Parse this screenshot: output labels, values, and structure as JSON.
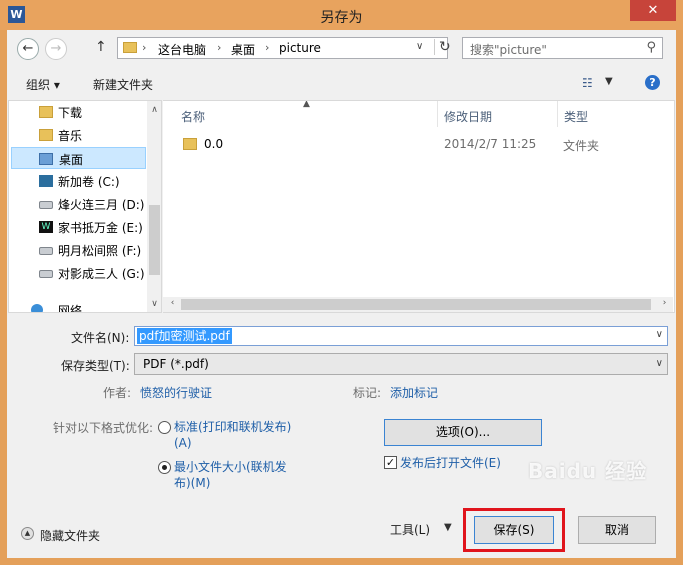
{
  "window": {
    "title": "另存为",
    "app_icon": "W",
    "close_glyph": "✕"
  },
  "nav": {
    "back_glyph": "←",
    "forward_glyph": "→",
    "up_glyph": "↑",
    "breadcrumbs": [
      "这台电脑",
      "桌面",
      "picture"
    ],
    "search_placeholder": "搜索\"picture\""
  },
  "toolbar": {
    "organize_label": "组织 ▾",
    "new_folder_label": "新建文件夹"
  },
  "sidebar": {
    "items": [
      {
        "label": "下载",
        "icon": "folder-icon"
      },
      {
        "label": "音乐",
        "icon": "folder-icon"
      },
      {
        "label": "桌面",
        "icon": "desktop-folder-icon",
        "selected": true
      },
      {
        "label": "新加卷 (C:)",
        "icon": "windows-drive-icon"
      },
      {
        "label": "烽火连三月 (D:)",
        "icon": "drive-icon"
      },
      {
        "label": "家书抵万金 (E:)",
        "icon": "app-drive-icon"
      },
      {
        "label": "明月松间照 (F:)",
        "icon": "drive-icon"
      },
      {
        "label": "对影成三人 (G:)",
        "icon": "drive-icon"
      },
      {
        "label": "网络",
        "icon": "network-icon"
      }
    ]
  },
  "filelist": {
    "columns": [
      "名称",
      "修改日期",
      "类型"
    ],
    "rows": [
      {
        "name": "0.0",
        "date": "2014/2/7 11:25",
        "type": "文件夹"
      }
    ]
  },
  "form": {
    "filename_label": "文件名(N):",
    "filename_value": "pdf加密测试.pdf",
    "savetype_label": "保存类型(T):",
    "savetype_value": "PDF (*.pdf)",
    "author_label": "作者:",
    "author_value": "愤怒的行驶证",
    "tags_label": "标记:",
    "tags_value": "添加标记",
    "optimize_label": "针对以下格式优化:",
    "radio_standard": "标准(打印和联机发布)(A)",
    "radio_minimum": "最小文件大小(联机发布)(M)",
    "options_button": "选项(O)...",
    "open_after_label": "发布后打开文件(E)",
    "open_after_checked": true
  },
  "footer": {
    "hide_folders_label": "隐藏文件夹",
    "tools_label": "工具(L)",
    "save_button": "保存(S)",
    "cancel_button": "取消"
  },
  "watermark": "Baidu 经验",
  "colors": {
    "title_bar": "#e8a35e",
    "close_button": "#c7443a",
    "highlight_box": "#e0141c",
    "selection": "#3399ff"
  }
}
